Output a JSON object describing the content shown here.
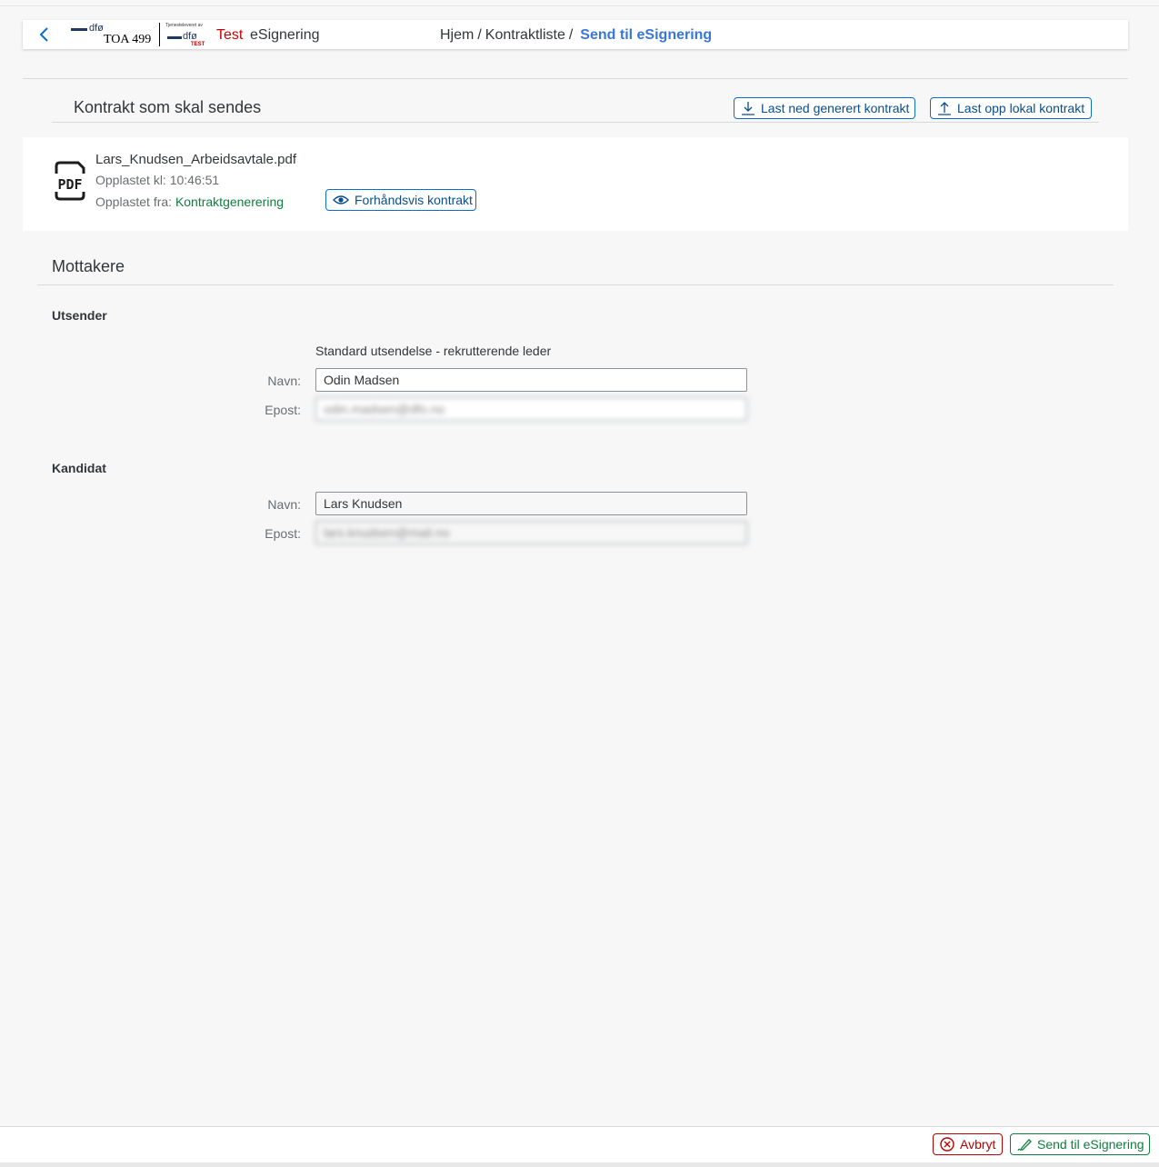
{
  "header": {
    "logo_main_small": "dfø",
    "logo_main_text": "TOA 499",
    "logo_secondary_small": "Tjenesteleveret av",
    "logo_secondary_dfo": "dfø",
    "logo_secondary_test": "TEST",
    "env_label": "Test",
    "app_title": "eSignering",
    "breadcrumb": [
      {
        "label": "Hjem"
      },
      {
        "label": "Kontraktliste"
      }
    ],
    "breadcrumb_current": "Send til eSignering"
  },
  "contract_section": {
    "title": "Kontrakt som skal sendes",
    "download_button": "Last ned generert kontrakt",
    "upload_button": "Last opp lokal kontrakt"
  },
  "file": {
    "icon": "pdf-icon",
    "icon_text": "PDF",
    "name": "Lars_Knudsen_Arbeidsavtale.pdf",
    "uploaded_time": "Opplastet kl: 10:46:51",
    "uploaded_from_label": "Opplastet fra:",
    "uploaded_from_value": "Kontraktgenerering",
    "preview_button": "Forhåndsvis kontrakt"
  },
  "recipients": {
    "title": "Mottakere",
    "sender": {
      "title": "Utsender",
      "mode": "Standard utsendelse - rekrutterende leder",
      "name_label": "Navn:",
      "name_value": "Odin Madsen",
      "email_label": "Epost:",
      "email_value": "odin.madsen@dfo.no"
    },
    "candidate": {
      "title": "Kandidat",
      "name_label": "Navn:",
      "name_value": "Lars Knudsen",
      "email_label": "Epost:",
      "email_value": "lars.knudsen@mail.no"
    }
  },
  "footer": {
    "cancel_button": "Avbryt",
    "send_button": "Send til eSignering"
  },
  "colors": {
    "accent": "#0a6ed1",
    "breadcrumb_current": "#3a76d8",
    "positive": "#107e3e",
    "negative": "#bb0000",
    "env_test": "#cc0000"
  }
}
